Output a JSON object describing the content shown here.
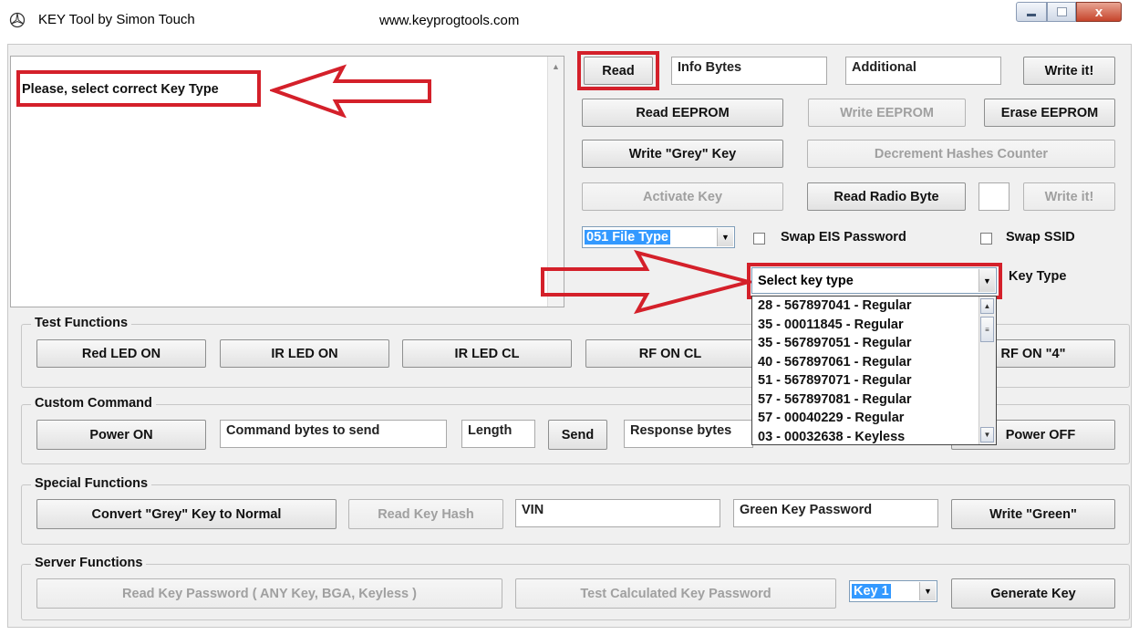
{
  "window": {
    "title": "KEY Tool by Simon Touch",
    "url": "www.keyprogtools.com",
    "minimize_icon": "minimize-icon",
    "maximize_icon": "maximize-icon",
    "close_label": "x"
  },
  "log": {
    "message": "Please, select correct Key Type"
  },
  "top_row": {
    "read": "Read",
    "info_bytes": "Info Bytes",
    "additional": "Additional",
    "write_it": "Write it!"
  },
  "eeprom_row": {
    "read_eeprom": "Read EEPROM",
    "write_eeprom": "Write EEPROM",
    "erase_eeprom": "Erase EEPROM"
  },
  "grey_row": {
    "write_grey": "Write \"Grey\" Key",
    "decrement": "Decrement Hashes Counter"
  },
  "activate_row": {
    "activate": "Activate Key",
    "read_radio": "Read Radio Byte",
    "radio_value": "",
    "write_it": "Write it!"
  },
  "options_row": {
    "file_type": "051 File Type",
    "swap_eis": "Swap EIS Password",
    "swap_ssid": "Swap SSID"
  },
  "key_type": {
    "selected": "Select key type",
    "label": "Key Type",
    "options": [
      "28 - 567897041 - Regular",
      "35 - 00011845 - Regular",
      "35 - 567897051 - Regular",
      "40 - 567897061 - Regular",
      "51 - 567897071 - Regular",
      "57 - 567897081 - Regular",
      "57 - 00040229 - Regular",
      "03 - 00032638 - Keyless"
    ]
  },
  "test_functions": {
    "title": "Test Functions",
    "red_led": "Red LED ON",
    "ir_led": "IR LED ON",
    "ir_led_cl": "IR LED CL",
    "rf_on_cl": "RF ON CL",
    "rf_on_4": "RF ON \"4\""
  },
  "custom_command": {
    "title": "Custom Command",
    "power_on": "Power ON",
    "command_bytes": "Command bytes to send",
    "length": "Length",
    "send": "Send",
    "response_bytes": "Response bytes",
    "power_off": "Power OFF"
  },
  "special_functions": {
    "title": "Special Functions",
    "convert_grey": "Convert \"Grey\" Key to Normal",
    "read_hash": "Read Key Hash",
    "vin": "VIN",
    "green_password": "Green Key Password",
    "write_green": "Write \"Green\""
  },
  "server_functions": {
    "title": "Server Functions",
    "read_password": "Read Key Password ( ANY Key, BGA, Keyless )",
    "test_password": "Test Calculated Key Password",
    "key_slot": "Key 1",
    "generate": "Generate Key"
  },
  "colors": {
    "annotation_red": "#d4202a",
    "selection_blue": "#3399ff",
    "window_bg": "#f0f0f0"
  }
}
